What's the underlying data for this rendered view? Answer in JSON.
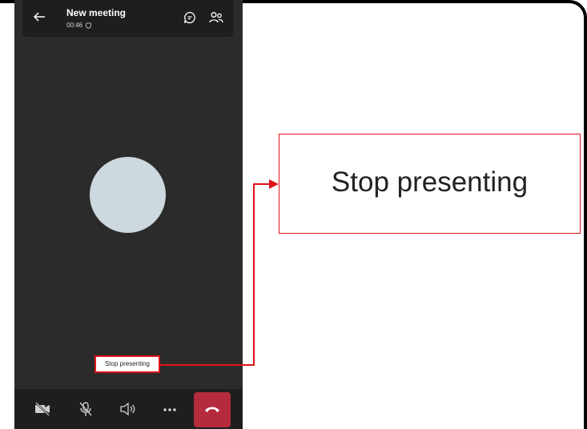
{
  "meeting": {
    "title": "New meeting",
    "timer": "00:46"
  },
  "toast": {
    "label": "Stop presenting"
  },
  "callout": {
    "label": "Stop presenting"
  },
  "colors": {
    "highlight": "#e0141b",
    "hangup": "#b32b3c",
    "avatar": "#cdd8df",
    "stage": "#2b2b2b",
    "bars": "#1e1e1e"
  },
  "icons": {
    "header": [
      "back-arrow-icon",
      "shield-icon",
      "chat-icon",
      "participants-icon"
    ],
    "callbar": [
      "video-off-icon",
      "mic-off-icon",
      "speaker-icon",
      "more-icon",
      "hang-up-icon"
    ]
  }
}
